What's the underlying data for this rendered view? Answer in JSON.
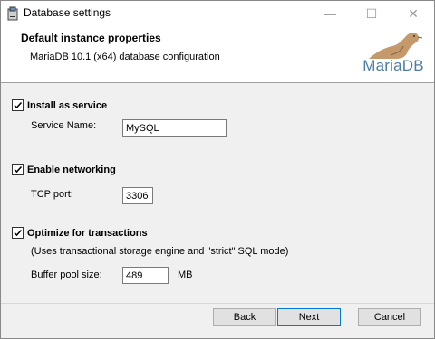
{
  "window": {
    "title": "Database settings",
    "controls": {
      "minimize": "—",
      "maximize": "☐",
      "close": "✕"
    }
  },
  "header": {
    "title": "Default instance properties",
    "subtitle": "MariaDB 10.1 (x64) database configuration",
    "logo_text": "MariaDB"
  },
  "options": {
    "install_service": {
      "label": "Install as service",
      "checked": true
    },
    "service_name": {
      "label": "Service Name:",
      "value": "MySQL"
    },
    "enable_networking": {
      "label": "Enable networking",
      "checked": true
    },
    "tcp_port": {
      "label": "TCP port:",
      "value": "3306"
    },
    "optimize_transactions": {
      "label": "Optimize for transactions",
      "checked": true
    },
    "transactions_note": "(Uses transactional storage engine and \"strict\" SQL mode)",
    "buffer_pool": {
      "label": "Buffer pool size:",
      "value": "489",
      "unit": "MB"
    }
  },
  "buttons": {
    "back": "Back",
    "next": "Next",
    "cancel": "Cancel"
  },
  "colors": {
    "accent": "#0078d7",
    "logo": "#4d7ca5",
    "seal": "#c49a6c"
  }
}
